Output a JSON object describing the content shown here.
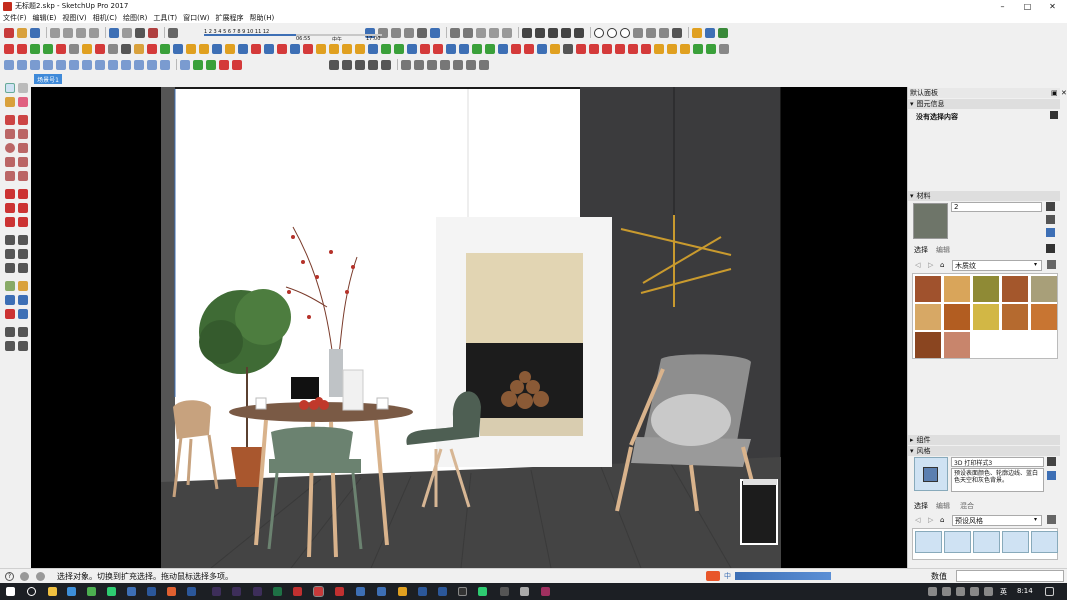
{
  "window": {
    "title": "无标题2.skp - SketchUp Pro 2017",
    "controls": [
      "–",
      "□",
      "✕"
    ]
  },
  "menu": [
    "文件(F)",
    "编辑(E)",
    "视图(V)",
    "相机(C)",
    "绘图(R)",
    "工具(T)",
    "窗口(W)",
    "扩展程序",
    "帮助(H)"
  ],
  "shadow": {
    "hours": "1 2 3 4 5 6 7 8 9 10 11 12",
    "time_start": "06:55",
    "time_mid": "中午",
    "time_end": "17:00"
  },
  "scene_tab": "场景号1",
  "tray": {
    "title": "默认面板",
    "entity_info": {
      "header": "图元信息",
      "content": "没有选择内容"
    },
    "materials": {
      "header": "材料",
      "name_value": "2",
      "tabs": [
        "选择",
        "编辑"
      ],
      "library": "木质纹",
      "swatches": [
        "#a0522d",
        "#d9a55a",
        "#8f8a35",
        "#a4572c",
        "#a89f79",
        "#d7a865",
        "#b25d21",
        "#d2b745",
        "#b56a2f",
        "#c87532",
        "#8a4520",
        "#c8856c"
      ]
    },
    "components": {
      "header": "组件"
    },
    "styles": {
      "header": "风格",
      "style_name": "3D 打印样式3",
      "description": "预设表面颜色、轮廓边线、蓝白色天空和灰色背景。",
      "tabs": [
        "选择",
        "编辑",
        "混合"
      ],
      "library": "预设风格"
    },
    "footer_label": "数值"
  },
  "status": {
    "text": "选择对象。切换到扩充选择。拖动鼠标选择多项。",
    "help": "?"
  },
  "taskbar": {
    "time": "8:14",
    "ime": "中",
    "lang": "英"
  }
}
